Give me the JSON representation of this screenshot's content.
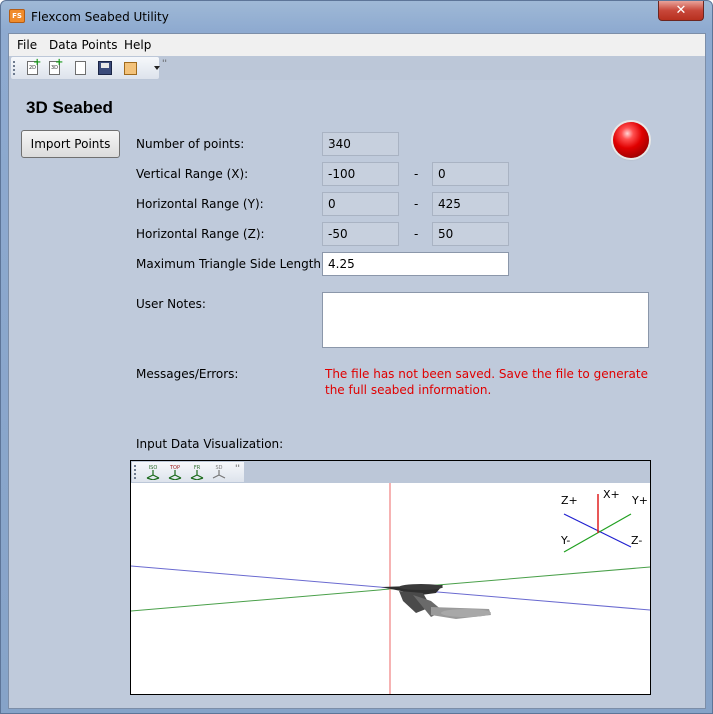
{
  "window": {
    "title": "Flexcom Seabed Utility",
    "app_icon_text": "FS",
    "close_glyph": "✕"
  },
  "menu": [
    "File",
    "Data Points",
    "Help"
  ],
  "toolbar": {
    "icons": [
      "new-2d-file-icon",
      "new-3d-file-icon",
      "open-file-icon",
      "save-icon",
      "multiple-files-icon",
      "dropdown-arrow-icon"
    ],
    "new2d_text": "2D",
    "new3d_text": "3D",
    "overflow": "''"
  },
  "page": {
    "title": "3D Seabed",
    "import_button": "Import Points",
    "status_color": "#e00000"
  },
  "fields": {
    "num_points": {
      "label": "Number of points:",
      "value": "340"
    },
    "vertical": {
      "label": "Vertical Range (X):",
      "min": "-100",
      "max": "0"
    },
    "horiz_y": {
      "label": "Horizontal Range (Y):",
      "min": "0",
      "max": "425"
    },
    "horiz_z": {
      "label": "Horizontal Range (Z):",
      "min": "-50",
      "max": "50"
    },
    "max_tri": {
      "label": "Maximum Triangle Side Length:",
      "value": "4.25"
    },
    "range_sep": "-",
    "notes": {
      "label": "User Notes:",
      "value": ""
    },
    "messages": {
      "label": "Messages/Errors:",
      "value": "The file has not been saved. Save the file to generate the full seabed information."
    }
  },
  "visualization": {
    "label": "Input Data Visualization:",
    "view_buttons": [
      "iso-view-icon",
      "top-view-icon",
      "front-view-icon",
      "side-view-icon"
    ],
    "view_texts": [
      "ISO",
      "TOP",
      "FR",
      "SD"
    ],
    "overflow": "''",
    "axes": {
      "x_plus": "X+",
      "y_plus": "Y+",
      "y_minus": "Y-",
      "z_plus": "Z+",
      "z_minus": "Z-"
    },
    "colors": {
      "x": "#e02020",
      "y": "#20a020",
      "z": "#2020d0"
    }
  }
}
